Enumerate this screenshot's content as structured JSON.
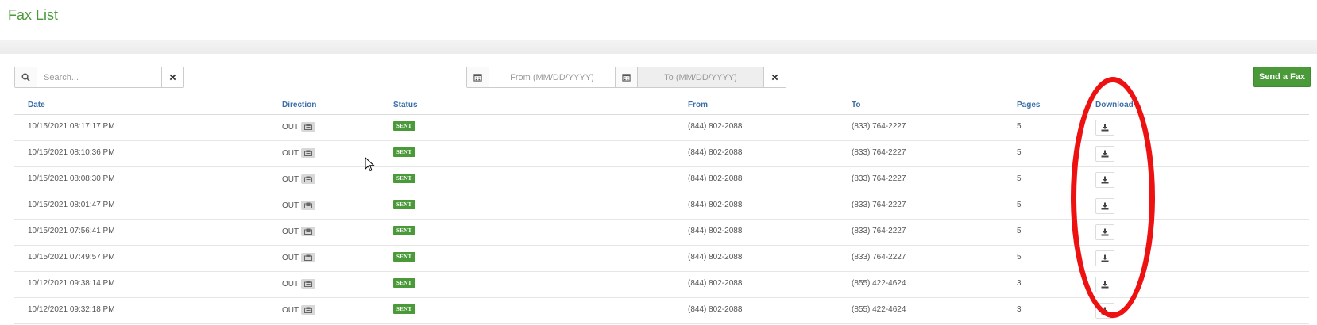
{
  "page": {
    "title": "Fax List"
  },
  "search": {
    "placeholder": "Search...",
    "icon": "search-icon",
    "clear_icon": "close-icon"
  },
  "date_range": {
    "from_placeholder": "From (MM/DD/YYYY)",
    "to_placeholder": "To (MM/DD/YYYY)",
    "icon": "calendar-icon",
    "clear_icon": "close-icon"
  },
  "send_fax_label": "Send a Fax",
  "table": {
    "columns": {
      "date": "Date",
      "direction": "Direction",
      "status": "Status",
      "from": "From",
      "to": "To",
      "pages": "Pages",
      "download": "Download"
    },
    "rows": [
      {
        "date": "10/15/2021 08:17:17 PM",
        "direction": "OUT",
        "status": "SENT",
        "from": "(844) 802-2088",
        "to": "(833) 764-2227",
        "pages": "5"
      },
      {
        "date": "10/15/2021 08:10:36 PM",
        "direction": "OUT",
        "status": "SENT",
        "from": "(844) 802-2088",
        "to": "(833) 764-2227",
        "pages": "5"
      },
      {
        "date": "10/15/2021 08:08:30 PM",
        "direction": "OUT",
        "status": "SENT",
        "from": "(844) 802-2088",
        "to": "(833) 764-2227",
        "pages": "5"
      },
      {
        "date": "10/15/2021 08:01:47 PM",
        "direction": "OUT",
        "status": "SENT",
        "from": "(844) 802-2088",
        "to": "(833) 764-2227",
        "pages": "5"
      },
      {
        "date": "10/15/2021 07:56:41 PM",
        "direction": "OUT",
        "status": "SENT",
        "from": "(844) 802-2088",
        "to": "(833) 764-2227",
        "pages": "5"
      },
      {
        "date": "10/15/2021 07:49:57 PM",
        "direction": "OUT",
        "status": "SENT",
        "from": "(844) 802-2088",
        "to": "(833) 764-2227",
        "pages": "5"
      },
      {
        "date": "10/12/2021 09:38:14 PM",
        "direction": "OUT",
        "status": "SENT",
        "from": "(844) 802-2088",
        "to": "(855) 422-4624",
        "pages": "3"
      },
      {
        "date": "10/12/2021 09:32:18 PM",
        "direction": "OUT",
        "status": "SENT",
        "from": "(844) 802-2088",
        "to": "(855) 422-4624",
        "pages": "3"
      }
    ]
  },
  "colors": {
    "brand_green": "#4a9a3a",
    "header_blue": "#3b6ea8",
    "annotation_red": "#ee1111"
  }
}
